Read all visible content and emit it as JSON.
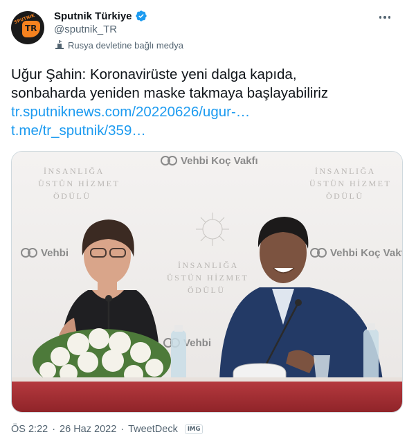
{
  "account": {
    "display_name": "Sputnik Türkiye",
    "handle": "@sputnik_TR",
    "state_media_label": "Rusya devletine bağlı medya",
    "avatar_text_top": "SPUTNIK",
    "avatar_text_bottom": "TR",
    "verified_icon": "verified-badge-icon",
    "brand_color": "#f5821f"
  },
  "tweet": {
    "text_line_1": "Uğur Şahin: Koronavirüste yeni dalga kapıda,",
    "text_line_2": "sonbaharda yeniden maske takmaya başlayabiliriz",
    "link_1": "tr.sputniknews.com/20220626/ugur-…",
    "link_2": "t.me/tr_sputnik/359…"
  },
  "media": {
    "backdrop_logo": "Vehbi Koç Vakfı",
    "backdrop_logo_partial": "Vehbi",
    "backdrop_award_1": "İNSANLIĞA",
    "backdrop_award_2": "ÜSTÜN HİZMET",
    "backdrop_award_3": "ÖDÜLÜ"
  },
  "meta": {
    "time": "ÖS 2:22",
    "date": "26 Haz 2022",
    "source": "TweetDeck",
    "img_badge": "IMG"
  },
  "colors": {
    "link": "#1d9bf0",
    "secondary_text": "#536471",
    "verified": "#1d9bf0"
  }
}
